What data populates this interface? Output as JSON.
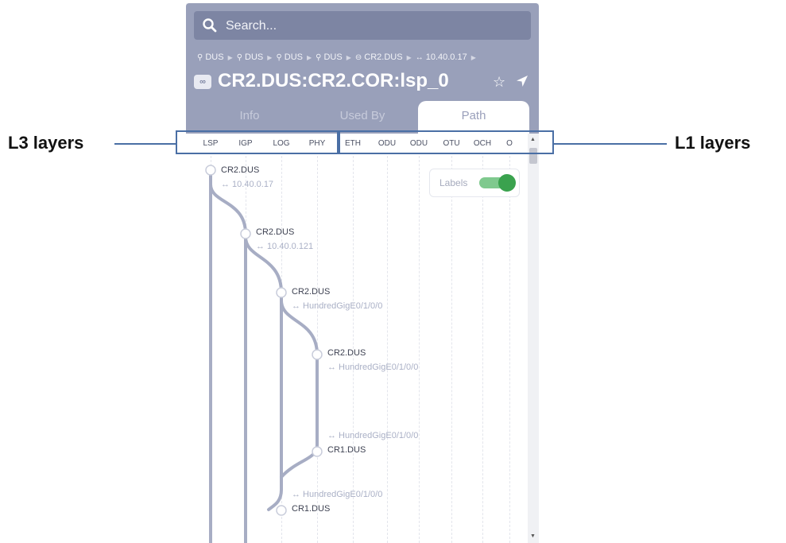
{
  "annotations": {
    "left": "L3 layers",
    "right": "L1 layers"
  },
  "search": {
    "placeholder": "Search..."
  },
  "breadcrumb": [
    {
      "icon": "location-pin-icon",
      "label": "DUS"
    },
    {
      "icon": "location-pin-icon",
      "label": "DUS"
    },
    {
      "icon": "location-pin-icon",
      "label": "DUS"
    },
    {
      "icon": "location-pin-icon",
      "label": "DUS"
    },
    {
      "icon": "router-icon",
      "label": "CR2.DUS"
    },
    {
      "icon": "link-arrows-icon",
      "label": "10.40.0.17"
    }
  ],
  "header": {
    "title": "CR2.DUS:CR2.COR:lsp_0",
    "badge": "∞"
  },
  "tabs": [
    {
      "label": "Info",
      "active": false
    },
    {
      "label": "Used By",
      "active": false
    },
    {
      "label": "Path",
      "active": true
    }
  ],
  "layers": [
    "LSP",
    "IGP",
    "LOG",
    "PHY",
    "ETH",
    "ODU",
    "ODU",
    "OTU",
    "OCH",
    "O"
  ],
  "labels_toggle": {
    "label": "Labels",
    "on": true
  },
  "nodes": [
    {
      "name": "CR2.DUS",
      "sub": "↔ 10.40.0.17"
    },
    {
      "name": "CR2.DUS",
      "sub": "↔ 10.40.0.121"
    },
    {
      "name": "CR2.DUS",
      "sub": "↔ HundredGigE0/1/0/0"
    },
    {
      "name": "CR2.DUS",
      "sub": "↔ HundredGigE0/1/0/0"
    },
    {
      "name": "CR1.DUS",
      "sub": "↔ HundredGigE0/1/0/0"
    },
    {
      "name": "CR1.DUS",
      "sub": "↔ HundredGigE0/1/0/0"
    }
  ],
  "colors": {
    "header_bg": "#99a0ba",
    "path_line": "#a7adc4",
    "toggle_on": "#3aa24e",
    "annotation_box": "#4a6fa5"
  }
}
